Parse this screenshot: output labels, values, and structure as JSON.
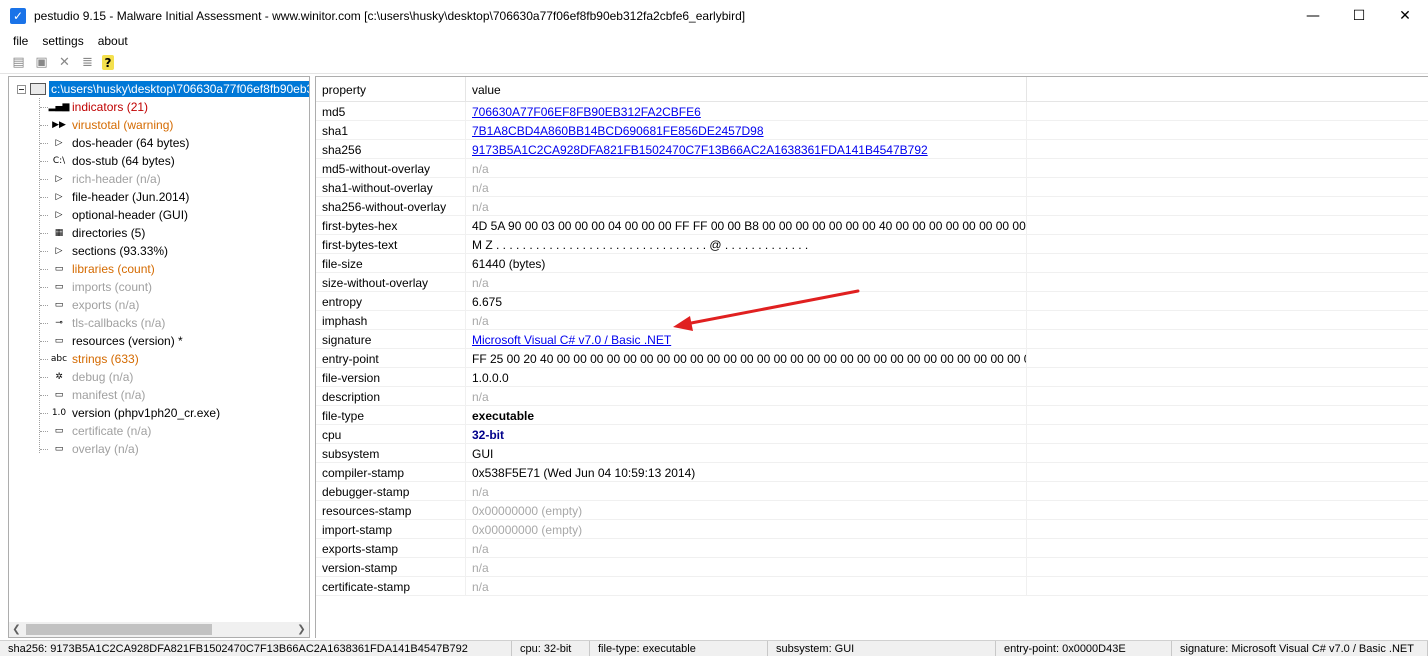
{
  "window": {
    "title": "pestudio 9.15 - Malware Initial Assessment - www.winitor.com [c:\\users\\husky\\desktop\\706630a77f06ef8fb90eb312fa2cbfe6_earlybird]",
    "minimize": "—",
    "maximize": "☐",
    "close": "✕"
  },
  "menu": [
    "file",
    "settings",
    "about"
  ],
  "toolbar": {
    "open_icon": "folder-open-icon",
    "save_icon": "save-icon",
    "delete_icon": "delete-icon",
    "list_icon": "list-icon",
    "help_icon": "help-icon"
  },
  "tree": {
    "root": "c:\\users\\husky\\desktop\\706630a77f06ef8fb90eb3",
    "items": [
      {
        "label": "indicators (21)",
        "color": "#c00000",
        "icon": "▂▄▆"
      },
      {
        "label": "virustotal (warning)",
        "color": "#d46a00",
        "icon": "▶▶"
      },
      {
        "label": "dos-header (64 bytes)",
        "color": "#000000",
        "icon": "▷"
      },
      {
        "label": "dos-stub (64 bytes)",
        "color": "#000000",
        "icon": "C:\\"
      },
      {
        "label": "rich-header (n/a)",
        "color": "#a0a0a0",
        "icon": "▷"
      },
      {
        "label": "file-header (Jun.2014)",
        "color": "#000000",
        "icon": "▷"
      },
      {
        "label": "optional-header (GUI)",
        "color": "#000000",
        "icon": "▷"
      },
      {
        "label": "directories (5)",
        "color": "#000000",
        "icon": "▦"
      },
      {
        "label": "sections (93.33%)",
        "color": "#000000",
        "icon": "▷"
      },
      {
        "label": "libraries (count)",
        "color": "#d46a00",
        "icon": "▭"
      },
      {
        "label": "imports (count)",
        "color": "#a0a0a0",
        "icon": "▭"
      },
      {
        "label": "exports (n/a)",
        "color": "#a0a0a0",
        "icon": "▭"
      },
      {
        "label": "tls-callbacks (n/a)",
        "color": "#a0a0a0",
        "icon": "⊸"
      },
      {
        "label": "resources (version) *",
        "color": "#000000",
        "icon": "▭"
      },
      {
        "label": "strings (633)",
        "color": "#d46a00",
        "icon": "abc"
      },
      {
        "label": "debug (n/a)",
        "color": "#a0a0a0",
        "icon": "✲"
      },
      {
        "label": "manifest (n/a)",
        "color": "#a0a0a0",
        "icon": "▭"
      },
      {
        "label": "version (phpv1ph20_cr.exe)",
        "color": "#000000",
        "icon": "1.0"
      },
      {
        "label": "certificate (n/a)",
        "color": "#a0a0a0",
        "icon": "▭"
      },
      {
        "label": "overlay (n/a)",
        "color": "#a0a0a0",
        "icon": "▭"
      }
    ]
  },
  "grid": {
    "headers": [
      "property",
      "value"
    ],
    "rows": [
      {
        "property": "md5",
        "value": "706630A77F06EF8FB90EB312FA2CBFE6",
        "style": "link"
      },
      {
        "property": "sha1",
        "value": "7B1A8CBD4A860BB14BCD690681FE856DE2457D98",
        "style": "link"
      },
      {
        "property": "sha256",
        "value": "9173B5A1C2CA928DFA821FB1502470C7F13B66AC2A1638361FDA141B4547B792",
        "style": "link"
      },
      {
        "property": "md5-without-overlay",
        "value": "n/a",
        "style": "gray"
      },
      {
        "property": "sha1-without-overlay",
        "value": "n/a",
        "style": "gray"
      },
      {
        "property": "sha256-without-overlay",
        "value": "n/a",
        "style": "gray"
      },
      {
        "property": "first-bytes-hex",
        "value": "4D 5A 90 00 03 00 00 00 04 00 00 00 FF FF 00 00 B8 00 00 00 00 00 00 00 40 00 00 00 00 00 00 00 00",
        "style": "normal"
      },
      {
        "property": "first-bytes-text",
        "value": "M Z . . . . . . . . . . . . . . . . . . . . . . . . . . . . . . . . @ . . . . . . . . . . . . .",
        "style": "normal"
      },
      {
        "property": "file-size",
        "value": "61440 (bytes)",
        "style": "normal"
      },
      {
        "property": "size-without-overlay",
        "value": "n/a",
        "style": "gray"
      },
      {
        "property": "entropy",
        "value": "6.675",
        "style": "normal"
      },
      {
        "property": "imphash",
        "value": "n/a",
        "style": "gray"
      },
      {
        "property": "signature",
        "value": "Microsoft Visual C# v7.0 / Basic .NET",
        "style": "link"
      },
      {
        "property": "entry-point",
        "value": "FF 25 00 20 40 00 00 00 00 00 00 00 00 00 00 00 00 00 00 00 00 00 00 00 00 00 00 00 00 00 00 00 00 00",
        "style": "normal"
      },
      {
        "property": "file-version",
        "value": "1.0.0.0",
        "style": "normal"
      },
      {
        "property": "description",
        "value": "n/a",
        "style": "gray"
      },
      {
        "property": "file-type",
        "value": "executable",
        "style": "bold"
      },
      {
        "property": "cpu",
        "value": "32-bit",
        "style": "boldblue"
      },
      {
        "property": "subsystem",
        "value": "GUI",
        "style": "normal"
      },
      {
        "property": "compiler-stamp",
        "value": "0x538F5E71 (Wed Jun 04 10:59:13 2014)",
        "style": "normal"
      },
      {
        "property": "debugger-stamp",
        "value": "n/a",
        "style": "gray"
      },
      {
        "property": "resources-stamp",
        "value": "0x00000000 (empty)",
        "style": "gray"
      },
      {
        "property": "import-stamp",
        "value": "0x00000000 (empty)",
        "style": "gray"
      },
      {
        "property": "exports-stamp",
        "value": "n/a",
        "style": "gray"
      },
      {
        "property": "version-stamp",
        "value": "n/a",
        "style": "gray"
      },
      {
        "property": "certificate-stamp",
        "value": "n/a",
        "style": "gray"
      }
    ]
  },
  "statusbar": [
    {
      "text": "sha256: 9173B5A1C2CA928DFA821FB1502470C7F13B66AC2A1638361FDA141B4547B792",
      "w": 512
    },
    {
      "text": "cpu: 32-bit",
      "w": 78
    },
    {
      "text": "file-type: executable",
      "w": 178
    },
    {
      "text": "subsystem: GUI",
      "w": 228
    },
    {
      "text": "entry-point: 0x0000D43E",
      "w": 176
    },
    {
      "text": "signature: Microsoft Visual C# v7.0 / Basic .NET",
      "w": 256
    }
  ]
}
